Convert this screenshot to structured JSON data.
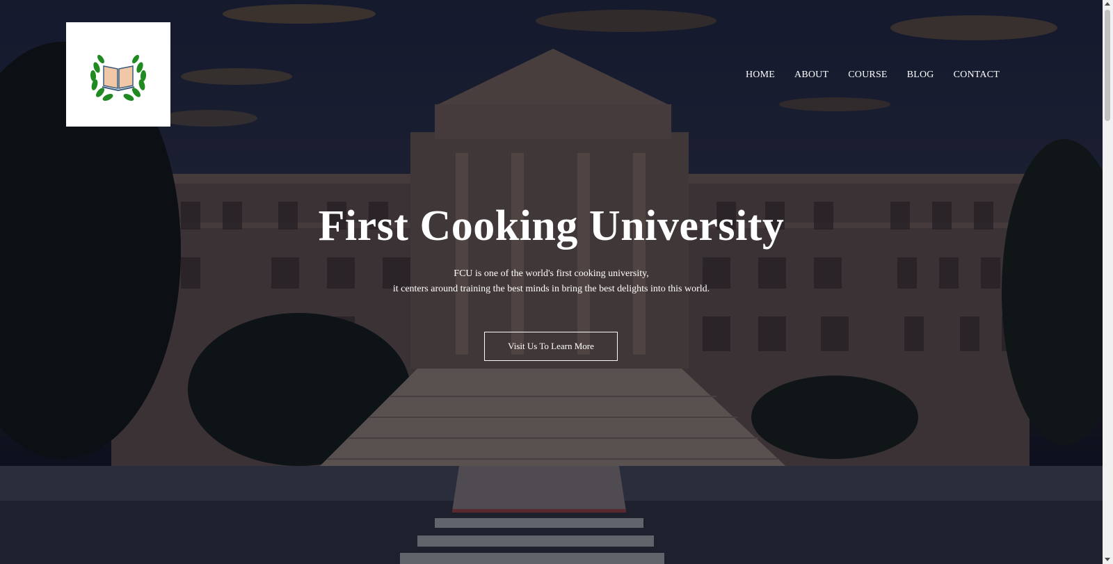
{
  "logo": {
    "icon": "laurel-book-icon",
    "leaf_color": "#1f8a1f",
    "book_color": "#f0c8a8"
  },
  "nav": {
    "items": [
      {
        "label": "HOME"
      },
      {
        "label": "ABOUT"
      },
      {
        "label": "COURSE"
      },
      {
        "label": "BLOG"
      },
      {
        "label": "CONTACT"
      }
    ]
  },
  "hero": {
    "title": "First Cooking University",
    "subtitle_line1": "FCU is one of the world's first cooking university,",
    "subtitle_line2": "it centers around training the best minds in bring the best delights into this world.",
    "cta_label": "Visit Us To Learn More",
    "background": "university-building-photo"
  }
}
